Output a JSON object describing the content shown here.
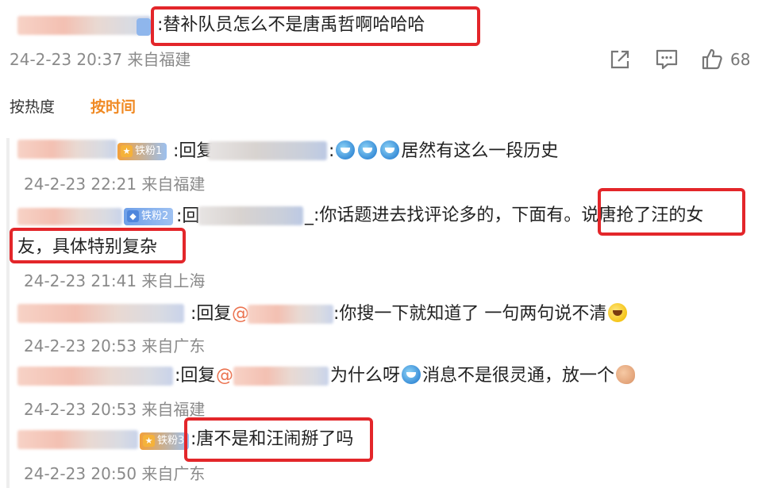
{
  "top_comment": {
    "text": ":替补队员怎么不是唐禹哲啊哈哈哈",
    "meta": "24-2-23 20:37 来自福建",
    "like_count": "68"
  },
  "sort_tabs": {
    "hot": "按热度",
    "time": "按时间"
  },
  "badges": {
    "r1": "铁粉1",
    "r2": "铁粉2",
    "r5": "铁粉3"
  },
  "replies": [
    {
      "reply_prefix": ":回复",
      "text": "居然有这么一段历史",
      "meta": "24-2-23 22:21 来自福建"
    },
    {
      "reply_prefix": ":回",
      "text_line1": "_:你话题进去找评论多的，下面有。说唐抢了汪的女",
      "text_line2": "友，具体特别复杂",
      "meta": "24-2-23 21:41 来自上海"
    },
    {
      "reply_prefix": ":回复",
      "mention": "@",
      "text": ":你搜一下就知道了 一句两句说不清",
      "meta": "24-2-23 20:53 来自广东"
    },
    {
      "reply_prefix": ":回复",
      "mention": "@",
      "text_a": "为什么呀",
      "text_b": "消息不是很灵通，放一个",
      "meta": "24-2-23 20:53 来自福建"
    },
    {
      "text": ":唐不是和汪闹掰了吗",
      "meta": "24-2-23 20:50 来自广东"
    }
  ],
  "colors": {
    "highlight": "#e3262a",
    "active_tab": "#f08a24",
    "mention": "#eb7350",
    "meta_gray": "#8a8a8a"
  }
}
